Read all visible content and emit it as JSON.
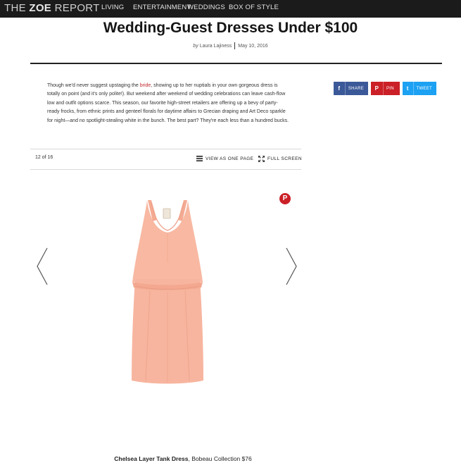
{
  "header": {
    "logo": {
      "part1": "THE ",
      "part2": "ZOE",
      "part3": " REPORT"
    },
    "nav": [
      "LIVING",
      "ENTERTAINMENT",
      "WEDDINGS",
      "BOX OF STYLE"
    ]
  },
  "article": {
    "title": "Wedding-Guest Dresses Under $100",
    "byline_prefix": "by",
    "author": "Laura Lajiness",
    "date": "May 10, 2016",
    "intro_before_link": "Though we'd never suggest upstaging the ",
    "intro_link": "bride",
    "intro_after_link": ", showing up to her nuptials in your own gorgeous dress is totally on point (and it's only polite!). But weekend after weekend of wedding celebrations can leave cash-flow low and outfit options scarce. This season, our favorite high-street retailers are offering up a bevy of party-ready frocks, from ethnic prints and genteel florals for daytime affairs to Grecian draping and Art Deco sparkle for night—and no spotlight-stealing white in the bunch. The best part? They're each less than a hundred bucks."
  },
  "share": {
    "facebook": {
      "icon": "f",
      "label": "SHARE",
      "color": "#3b5998"
    },
    "pinterest": {
      "icon": "P",
      "label": "PIN",
      "color": "#cb2027"
    },
    "twitter": {
      "icon": "t",
      "label": "TWEET",
      "color": "#1da1f2"
    }
  },
  "gallery": {
    "counter": "12 of 16",
    "view_one_page": "VIEW AS ONE PAGE",
    "full_screen": "FULL SCREEN",
    "pin_badge_icon": "P",
    "caption_name": "Chelsea Layer Tank Dress",
    "caption_rest": ", Bobeau Collection $76",
    "dress_color": "#f7b8a2"
  }
}
